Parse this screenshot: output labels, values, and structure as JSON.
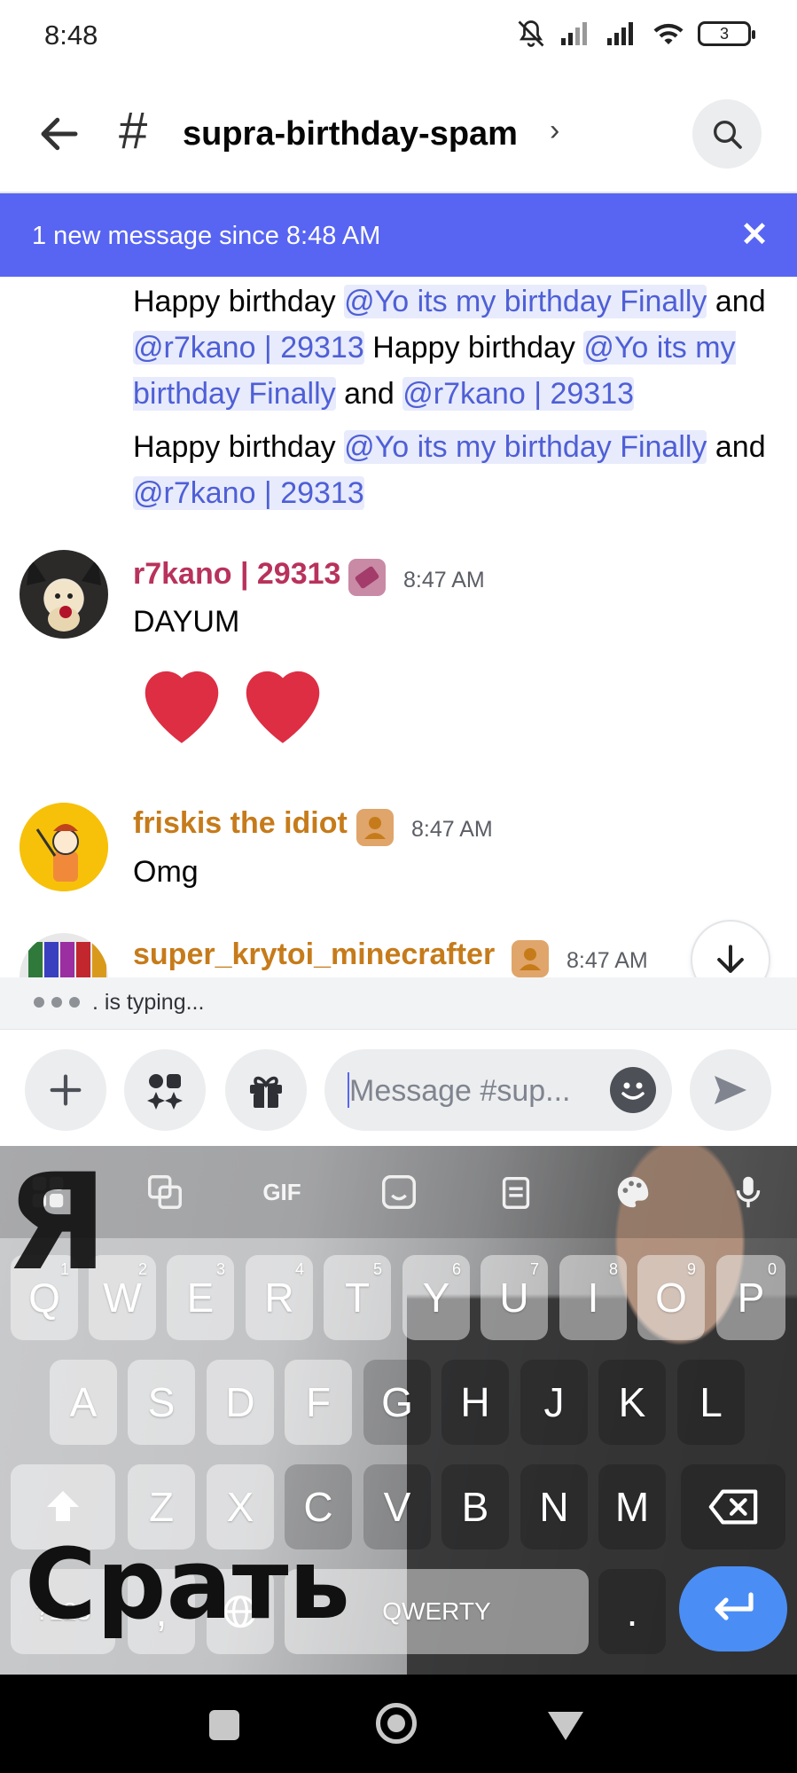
{
  "status_bar": {
    "time": "8:48",
    "battery": "3"
  },
  "header": {
    "hash": "#",
    "channel_name": "supra-birthday-spam",
    "chevron": "›"
  },
  "new_messages_bar": {
    "text": "1 new message since 8:48 AM",
    "close": "✕"
  },
  "messages": [
    {
      "continuation": true,
      "segments": [
        {
          "type": "text",
          "value": "Happy birthday "
        },
        {
          "type": "mention",
          "value": "@Yo its my birthday Finally"
        },
        {
          "type": "text",
          "value": " and "
        },
        {
          "type": "mention",
          "value": "@r7kano | 29313"
        },
        {
          "type": "text",
          "value": " Happy birthday "
        },
        {
          "type": "mention",
          "value": "@Yo its my birthday Finally"
        },
        {
          "type": "text",
          "value": " and "
        },
        {
          "type": "mention",
          "value": "@r7kano | 29313"
        }
      ]
    },
    {
      "continuation": true,
      "segments": [
        {
          "type": "text",
          "value": "Happy birthday "
        },
        {
          "type": "mention",
          "value": "@Yo its my birthday Finally"
        },
        {
          "type": "text",
          "value": " and "
        },
        {
          "type": "mention",
          "value": "@r7kano | 29313"
        }
      ]
    },
    {
      "author": "r7kano | 29313",
      "author_color": "#b8325c",
      "timestamp": "8:47 AM",
      "text": "DAYUM",
      "emoji": "hearts"
    },
    {
      "author": "friskis the idiot",
      "author_color": "#c67b1a",
      "timestamp": "8:47 AM",
      "text": "Omg"
    },
    {
      "author": "super_krytoi_minecrafter",
      "author_color": "#c67b1a",
      "timestamp": "8:47 AM"
    }
  ],
  "typing": {
    "text": ". is typing..."
  },
  "composer": {
    "placeholder": "Message #sup..."
  },
  "keyboard": {
    "toolbar": {
      "gif": "GIF"
    },
    "row1": [
      {
        "k": "Q",
        "h": "1"
      },
      {
        "k": "W",
        "h": "2"
      },
      {
        "k": "E",
        "h": "3"
      },
      {
        "k": "R",
        "h": "4"
      },
      {
        "k": "T",
        "h": "5"
      },
      {
        "k": "Y",
        "h": "6"
      },
      {
        "k": "U",
        "h": "7"
      },
      {
        "k": "I",
        "h": "8"
      },
      {
        "k": "O",
        "h": "9"
      },
      {
        "k": "P",
        "h": "0"
      }
    ],
    "row2": [
      "A",
      "S",
      "D",
      "F",
      "G",
      "H",
      "J",
      "K",
      "L"
    ],
    "row3": [
      "Z",
      "X",
      "C",
      "V",
      "B",
      "N",
      "M"
    ],
    "symbols": "?123",
    "comma": ",",
    "space": "QWERTY",
    "period": ".",
    "overlay_top": "Я",
    "overlay_bottom": "Срать"
  }
}
